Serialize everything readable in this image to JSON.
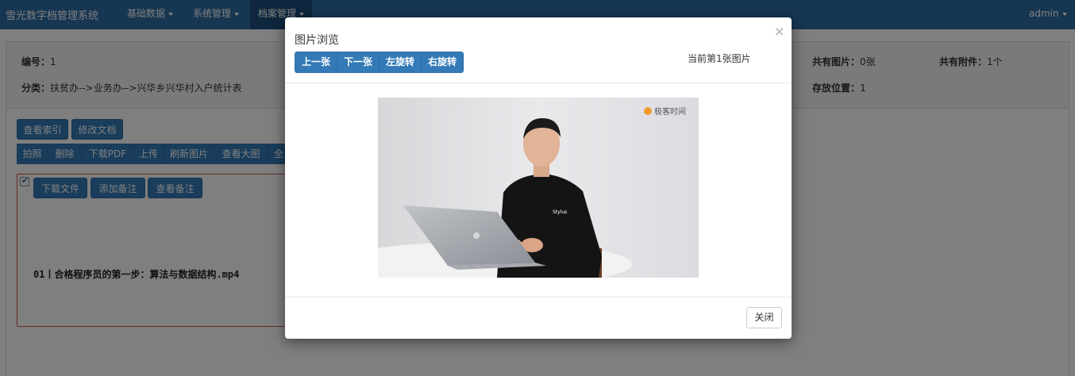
{
  "navbar": {
    "brand": "雪光数字档管理系统",
    "items": [
      "基础数据",
      "系统管理",
      "档案管理"
    ],
    "user": "admin"
  },
  "record": {
    "id_label": "编号：",
    "id_value": "1",
    "category_label": "分类：",
    "category_value": "扶贫办-->业务办-->兴华乡兴华村入户统计表",
    "images_label": "共有图片：",
    "images_value": "0张",
    "attachments_label": "共有附件：",
    "attachments_value": "1个",
    "location_label": "存放位置：",
    "location_value": "1"
  },
  "actions": {
    "view_index": "查看索引",
    "edit_doc": "修改文档"
  },
  "toolbar": [
    "拍照",
    "删除",
    "下载PDF",
    "上传",
    "刷新图片",
    "查看大图",
    "全"
  ],
  "file_card": {
    "download": "下载文件",
    "add_note": "添加备注",
    "view_note": "查看备注",
    "filename": "01丨合格程序员的第一步：算法与数据结构.mp4"
  },
  "modal": {
    "title": "图片浏览",
    "close_x": "×",
    "buttons": [
      "上一张",
      "下一张",
      "左旋转",
      "右旋转"
    ],
    "counter": "当前第1张图片",
    "watermark": "极客时间",
    "shirt_text": "Stylus",
    "close_button": "关闭"
  }
}
